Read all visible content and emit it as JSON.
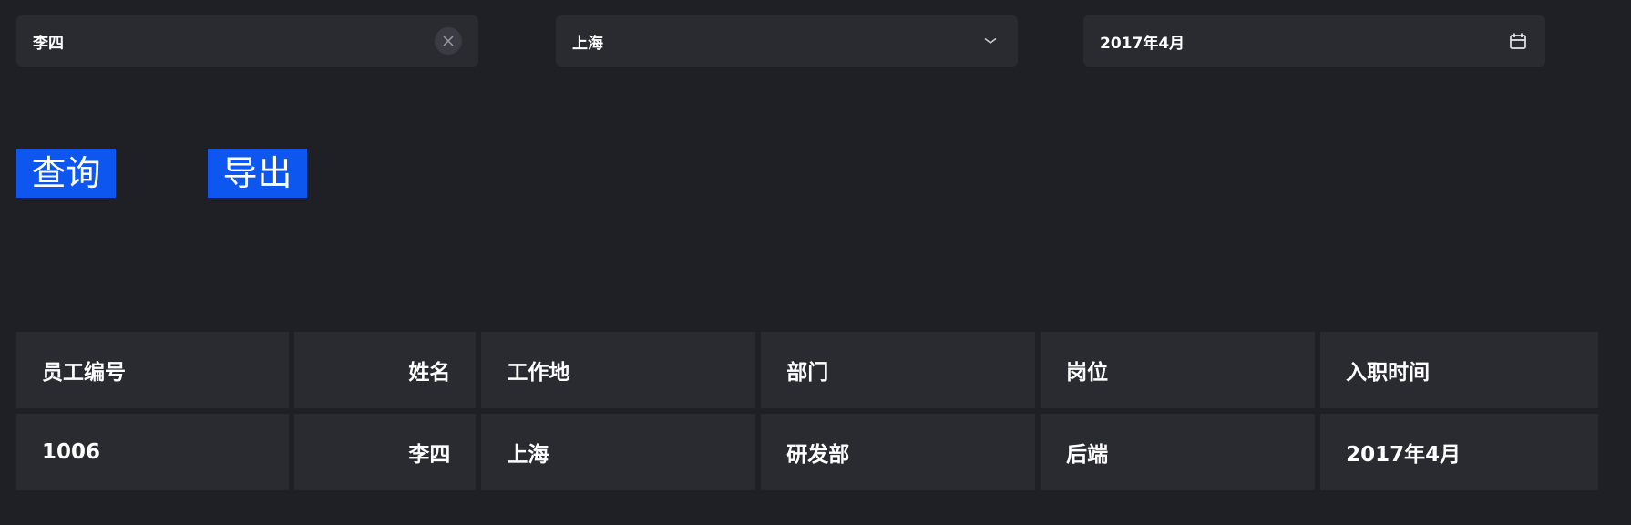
{
  "filters": {
    "name": {
      "value": "李四"
    },
    "city": {
      "value": "上海"
    },
    "date": {
      "value": "2017年4月"
    }
  },
  "buttons": {
    "query_label": "查询",
    "export_label": "导出"
  },
  "table": {
    "headers": [
      "员工编号",
      "姓名",
      "工作地",
      "部门",
      "岗位",
      "入职时间"
    ],
    "rows": [
      [
        "1006",
        "李四",
        "上海",
        "研发部",
        "后端",
        "2017年4月"
      ]
    ]
  }
}
